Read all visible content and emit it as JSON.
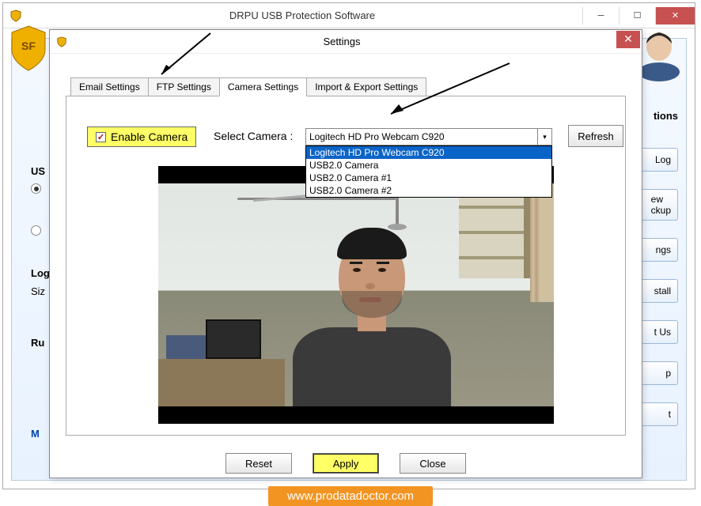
{
  "outer_window": {
    "title": "DRPU USB Protection Software"
  },
  "settings_dialog": {
    "title": "Settings",
    "tabs": [
      {
        "label": "Email Settings"
      },
      {
        "label": "FTP Settings"
      },
      {
        "label": "Camera Settings"
      },
      {
        "label": "Import & Export Settings"
      }
    ],
    "enable_camera_label": "Enable Camera",
    "select_camera_label": "Select Camera :",
    "selected_camera": "Logitech HD Pro Webcam C920",
    "camera_options": [
      "Logitech HD Pro Webcam C920",
      "USB2.0 Camera",
      "USB2.0 Camera #1",
      "USB2.0 Camera #2"
    ],
    "refresh_label": "Refresh",
    "reset_label": "Reset",
    "apply_label": "Apply",
    "close_label": "Close"
  },
  "side_buttons": [
    "Log",
    "ew\nckup",
    "ngs",
    "stall",
    "t Us",
    "p",
    "t"
  ],
  "left_peek": {
    "us_label": "US",
    "log_label": "Log",
    "size_label": "Siz",
    "run_label": "Ru",
    "m_label": "M"
  },
  "footer_url": "www.prodatadoctor.com"
}
